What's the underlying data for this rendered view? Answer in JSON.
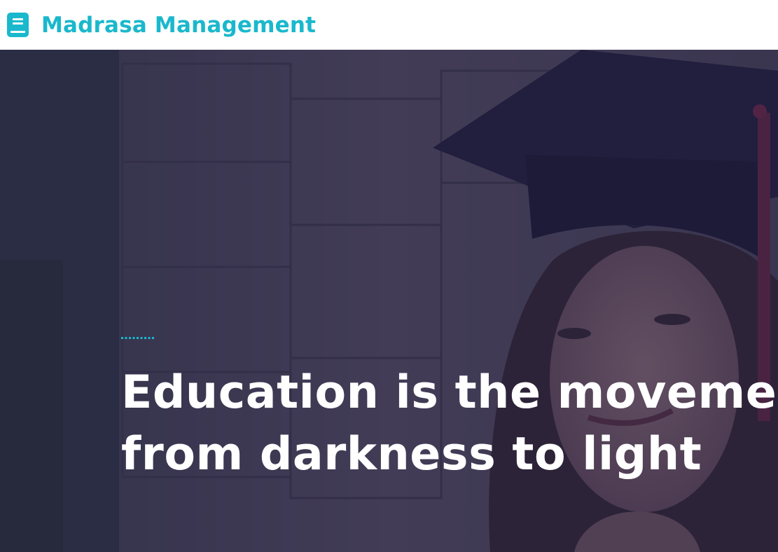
{
  "navbar": {
    "brand_text": "Madrasa Management",
    "brand_icon": "book-icon",
    "brand_color": "#1ab8cc"
  },
  "hero": {
    "accent_color": "#1ab8cc",
    "title_line_1": "Education is the movement",
    "title_line_2": "from darkness to light",
    "background": "graduate-photo"
  }
}
